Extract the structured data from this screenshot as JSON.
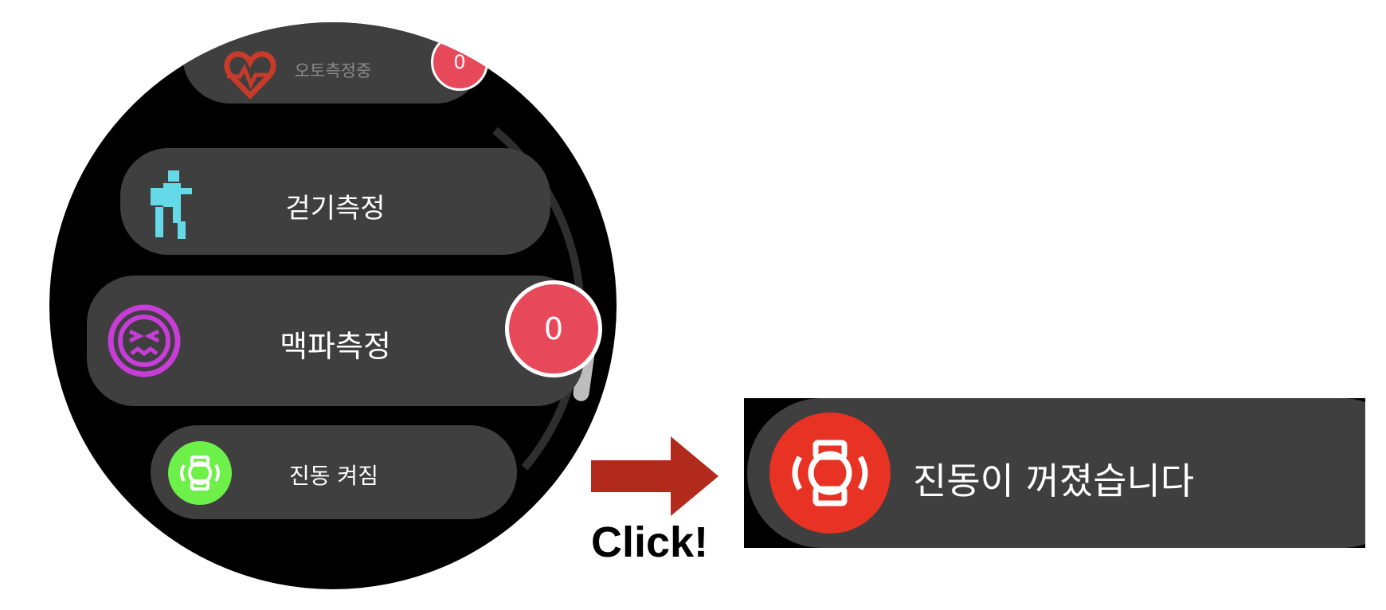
{
  "watch_list": {
    "items": [
      {
        "label": "오토측정중",
        "badge": "0",
        "icon": "heart-icon"
      },
      {
        "label": "걷기측정",
        "icon": "walking-person-icon"
      },
      {
        "label": "맥파측정",
        "badge": "0",
        "icon": "face-icon"
      },
      {
        "label": "진동 켜짐",
        "icon": "vibration-icon"
      }
    ]
  },
  "annotation": {
    "click_label": "Click!"
  },
  "toast": {
    "message": "진동이 꺼졌습니다",
    "icon": "vibration-off-icon"
  },
  "colors": {
    "arrow": "#b22a1c",
    "vibration_on": "#6ef04a",
    "vibration_off": "#e83224",
    "badge": "#e8495a",
    "walk_icon": "#66d9e8",
    "face_icon": "#c83cd8",
    "heart_icon": "#c83a2a"
  }
}
